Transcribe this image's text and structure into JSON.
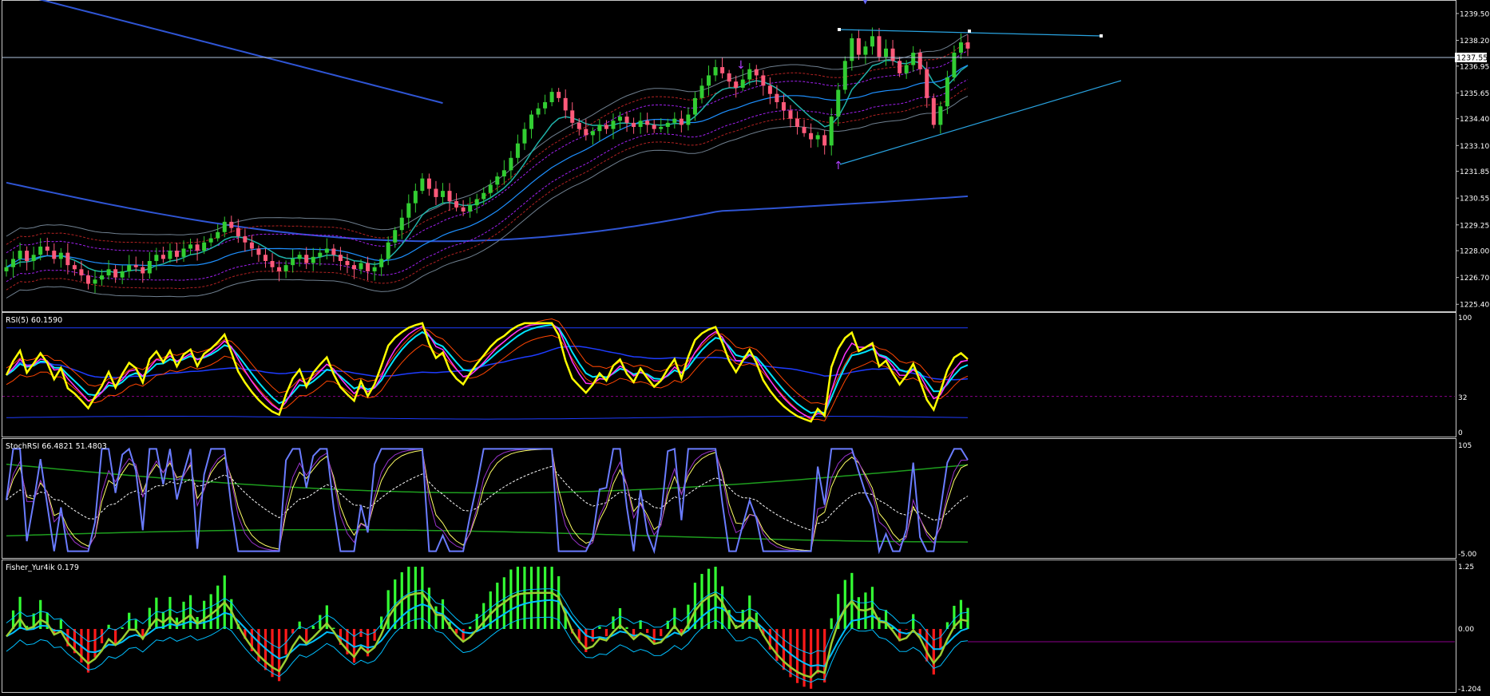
{
  "colors": {
    "background": "#000000",
    "axis": "#c0c0c0",
    "bull_candle": "#32cd32",
    "bear_candle": "#ff5a7a",
    "rsi_line": "#ffff00",
    "rsi_fast_ma": "#ff33ff",
    "rsi_slow_ma": "#00e5ff",
    "band_red": "#ff4500",
    "band_blue": "#1e3cff",
    "stoch_main": "#6a7cff",
    "stoch_signal": "#ffff66",
    "stoch_ma_white": "#ffffff",
    "stoch_green": "#1e9e1e",
    "fisher_pos": "#33ff33",
    "fisher_neg": "#ff1a1a",
    "fisher_line": "#9acd32",
    "fisher_signal": "#00bfff",
    "trendline": "#29a3e0",
    "ma_long": "#2f55d4",
    "ma_mid": "#20b2aa"
  },
  "price_panel": {
    "current_price": "1237.55",
    "axis_labels": [
      "1239.50",
      "1238.20",
      "1236.95",
      "1235.65",
      "1234.40",
      "1233.10",
      "1231.85",
      "1230.55",
      "1229.25",
      "1228.00",
      "1226.70",
      "1225.40"
    ]
  },
  "rsi_panel": {
    "title": "RSI(5) 60.1590",
    "axis_labels": [
      "100",
      "32",
      "0"
    ]
  },
  "stoch_panel": {
    "title": "StochRSI 66.4821 51.4803",
    "axis_labels": [
      "105",
      "-5.00"
    ]
  },
  "fisher_panel": {
    "title": "Fisher_Yur4ik 0.179",
    "axis_labels": [
      "1.25",
      "0.00",
      "-1.204"
    ]
  },
  "chart_data": [
    {
      "type": "line",
      "title": "",
      "price_levels": [
        1239.5,
        1238.2,
        1236.95,
        1235.65,
        1234.4,
        1233.1,
        1231.85,
        1230.55,
        1229.25,
        1228.0,
        1226.7,
        1225.4
      ],
      "current_price": 1237.55,
      "ylim": [
        1225.4,
        1240.2
      ],
      "close_series": [
        1227.2,
        1227.6,
        1228.0,
        1227.5,
        1227.8,
        1228.2,
        1228.0,
        1227.6,
        1227.9,
        1227.3,
        1227.1,
        1226.8,
        1226.4,
        1226.6,
        1226.8,
        1227.1,
        1226.7,
        1227.0,
        1227.3,
        1227.2,
        1226.9,
        1227.5,
        1227.8,
        1227.6,
        1228.0,
        1227.7,
        1228.1,
        1228.3,
        1228.0,
        1228.4,
        1228.6,
        1228.9,
        1229.4,
        1229.1,
        1228.7,
        1228.4,
        1228.1,
        1227.8,
        1227.5,
        1227.2,
        1227.0,
        1227.3,
        1227.6,
        1227.8,
        1227.4,
        1227.7,
        1227.9,
        1228.1,
        1227.8,
        1227.5,
        1227.3,
        1227.1,
        1227.4,
        1227.0,
        1227.2,
        1227.6,
        1228.4,
        1229.0,
        1229.6,
        1230.3,
        1230.9,
        1231.5,
        1231.0,
        1230.6,
        1230.9,
        1230.4,
        1230.1,
        1229.9,
        1230.2,
        1230.5,
        1230.8,
        1231.2,
        1231.6,
        1231.9,
        1232.5,
        1233.2,
        1233.9,
        1234.6,
        1234.9,
        1235.2,
        1235.7,
        1235.4,
        1234.8,
        1234.2,
        1233.9,
        1233.6,
        1233.8,
        1234.1,
        1233.9,
        1234.3,
        1234.5,
        1234.2,
        1234.0,
        1234.3,
        1234.1,
        1233.9,
        1234.0,
        1234.2,
        1234.4,
        1234.1,
        1234.6,
        1235.4,
        1236.0,
        1236.5,
        1236.9,
        1236.6,
        1236.2,
        1235.9,
        1236.3,
        1236.8,
        1236.5,
        1236.0,
        1235.6,
        1235.2,
        1234.8,
        1234.4,
        1234.0,
        1233.7,
        1233.4,
        1233.6,
        1233.1,
        1234.5,
        1235.8,
        1237.2,
        1238.3,
        1237.5,
        1237.9,
        1238.4,
        1237.4,
        1237.8,
        1237.2,
        1236.6,
        1237.0,
        1237.6,
        1236.8,
        1235.4,
        1234.1,
        1235.0,
        1236.4,
        1237.6,
        1238.1,
        1237.8
      ]
    },
    {
      "type": "line",
      "title": "RSI(5) 60.1590",
      "ylim": [
        0,
        100
      ],
      "levels": [
        32
      ],
      "last_value": 60.159
    },
    {
      "type": "line",
      "title": "StochRSI 66.4821 51.4803",
      "ylim": [
        -5,
        105
      ],
      "series": [
        {
          "name": "StochRSI",
          "last": 66.4821
        },
        {
          "name": "Signal",
          "last": 51.4803
        }
      ]
    },
    {
      "type": "bar",
      "title": "Fisher_Yur4ik 0.179",
      "ylim": [
        -1.204,
        1.25
      ],
      "last_value": 0.179
    }
  ]
}
